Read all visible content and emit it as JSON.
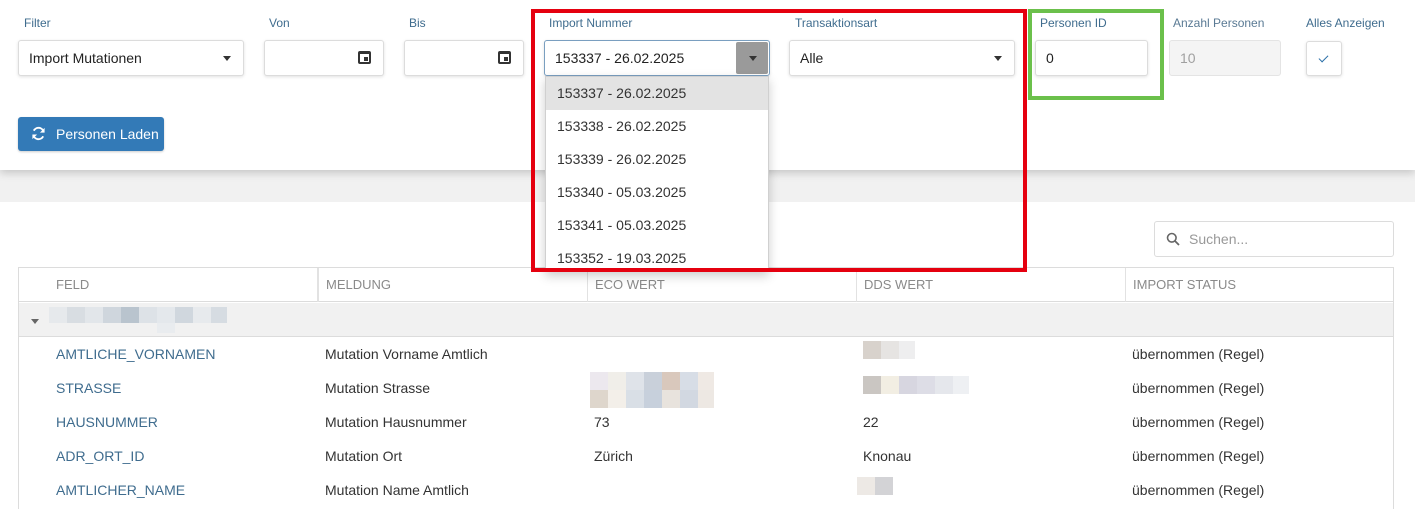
{
  "filters": {
    "filter_label": "Filter",
    "filter_value": "Import Mutationen",
    "von_label": "Von",
    "von_value": "",
    "bis_label": "Bis",
    "bis_value": "",
    "import_label": "Import Nummer",
    "import_value": "153337 - 26.02.2025",
    "transaktion_label": "Transaktionsart",
    "transaktion_value": "Alle",
    "personen_id_label": "Personen ID",
    "personen_id_value": "0",
    "anzahl_label": "Anzahl Personen",
    "anzahl_value": "10",
    "alles_label": "Alles Anzeigen",
    "alles_checked": true
  },
  "load_button": "Personen Laden",
  "import_options": [
    "153337 - 26.02.2025",
    "153338 - 26.02.2025",
    "153339 - 26.02.2025",
    "153340 - 05.03.2025",
    "153341 - 05.03.2025",
    "153352 - 19.03.2025"
  ],
  "search_placeholder": "Suchen...",
  "table": {
    "headers": [
      "FELD",
      "MELDUNG",
      "ECO WERT",
      "DDS WERT",
      "IMPORT STATUS"
    ],
    "rows": [
      {
        "feld": "AMTLICHE_VORNAMEN",
        "meldung": "Mutation Vorname Amtlich",
        "eco": "",
        "dds": "",
        "status": "übernommen (Regel)"
      },
      {
        "feld": "STRASSE",
        "meldung": "Mutation Strasse",
        "eco": "",
        "dds": "",
        "status": "übernommen (Regel)"
      },
      {
        "feld": "HAUSNUMMER",
        "meldung": "Mutation Hausnummer",
        "eco": "73",
        "dds": "22",
        "status": "übernommen (Regel)"
      },
      {
        "feld": "ADR_ORT_ID",
        "meldung": "Mutation Ort",
        "eco": "Zürich",
        "dds": "Knonau",
        "status": "übernommen (Regel)"
      },
      {
        "feld": "AMTLICHER_NAME",
        "meldung": "Mutation Name Amtlich",
        "eco": "",
        "dds": "",
        "status": "übernommen (Regel)"
      }
    ]
  },
  "colors": {
    "primary": "#337ab7",
    "highlight_red": "#e5000f",
    "highlight_green": "#6bc04b",
    "label_blue": "#3f6c8e"
  }
}
